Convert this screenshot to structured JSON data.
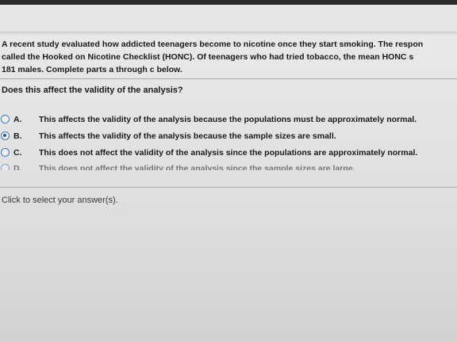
{
  "problem": {
    "intro_lines": [
      "A recent study evaluated how addicted teenagers become to nicotine once they start smoking. The respon",
      "called the Hooked on Nicotine Checklist (HONC). Of teenagers who had tried tobacco, the mean HONC s",
      "181 males. Complete parts a through c below."
    ],
    "question": "Does this affect the validity of the analysis?",
    "options": [
      {
        "letter": "A.",
        "text": "This affects the validity of the analysis because the populations must be approximately normal.",
        "selected": false
      },
      {
        "letter": "B.",
        "text": "This affects the validity of the analysis because the sample sizes are small.",
        "selected": true
      },
      {
        "letter": "C.",
        "text": "This does not affect the validity of the analysis since the populations are approximately normal.",
        "selected": false
      },
      {
        "letter": "D.",
        "text": "This does not affect the validity of the analysis since the sample sizes are large.",
        "selected": false
      }
    ],
    "instruction": "Click to select your answer(s)."
  },
  "colors": {
    "radio_border": "#3b7bb8",
    "radio_selected": "#1e5aa0"
  }
}
